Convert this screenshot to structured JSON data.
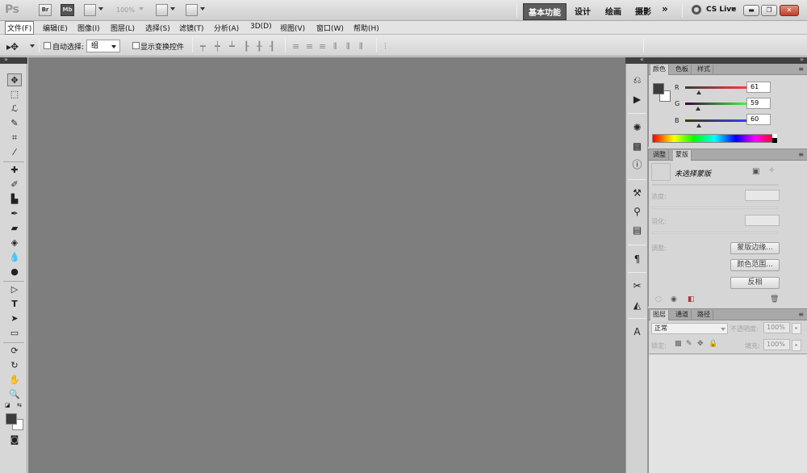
{
  "appbar": {
    "logo": "Ps",
    "br_label": "Br",
    "mb_label": "Mb",
    "zoom": "100%",
    "workspaces": [
      "基本功能",
      "设计",
      "绘画",
      "摄影"
    ],
    "more": "»",
    "cs_live": "CS Live"
  },
  "menu": [
    "文件(F)",
    "编辑(E)",
    "图像(I)",
    "图层(L)",
    "选择(S)",
    "滤镜(T)",
    "分析(A)",
    "3D(D)",
    "视图(V)",
    "窗口(W)",
    "帮助(H)"
  ],
  "options": {
    "auto_select_label": "自动选择:",
    "auto_select_value": "组",
    "show_transform_label": "显示变换控件"
  },
  "color_panel": {
    "tabs": [
      "颜色",
      "色板",
      "样式"
    ],
    "r_label": "R",
    "r_value": "61",
    "g_label": "G",
    "g_value": "59",
    "b_label": "B",
    "b_value": "60",
    "foreground": "#3d3b3c",
    "background": "#ffffff"
  },
  "masks_panel": {
    "tabs": [
      "调整",
      "蒙版"
    ],
    "title": "未选择蒙版",
    "density_label": "浓度:",
    "feather_label": "羽化:",
    "refine_label": "调整:",
    "btn_mask_edge": "蒙版边缘...",
    "btn_color_range": "颜色范围...",
    "btn_invert": "反相"
  },
  "layers_panel": {
    "tabs": [
      "图层",
      "通道",
      "路径"
    ],
    "blend_mode": "正常",
    "opacity_label": "不透明度:",
    "opacity_value": "100%",
    "lock_label": "锁定:",
    "fill_label": "填充:",
    "fill_value": "100%"
  }
}
